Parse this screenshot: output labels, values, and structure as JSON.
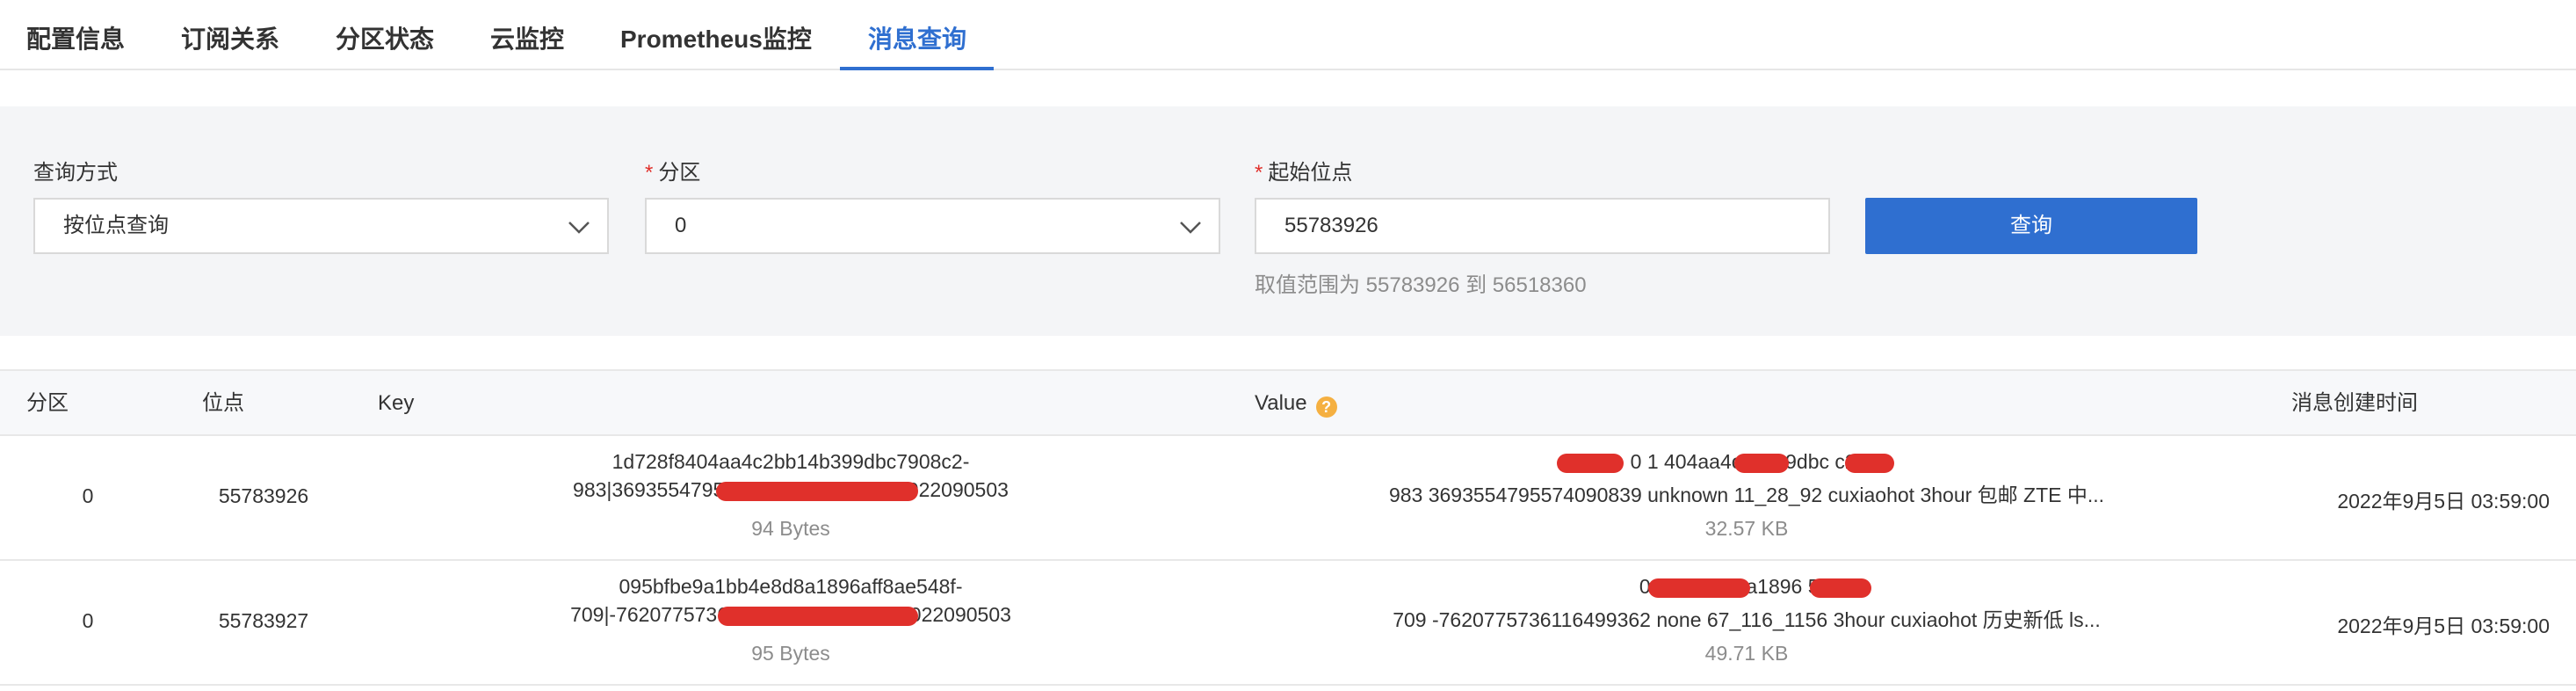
{
  "tabs": [
    {
      "label": "配置信息"
    },
    {
      "label": "订阅关系"
    },
    {
      "label": "分区状态"
    },
    {
      "label": "云监控"
    },
    {
      "label": "Prometheus监控"
    },
    {
      "label": "消息查询",
      "active": true
    }
  ],
  "query": {
    "method_label": "查询方式",
    "method_value": "按位点查询",
    "partition_label": "分区",
    "partition_value": "0",
    "offset_label": "起始位点",
    "offset_value": "55783926",
    "required_mark": "*",
    "range_hint": "取值范围为 55783926 到 56518360",
    "submit_label": "查询"
  },
  "table": {
    "columns": {
      "partition": "分区",
      "offset": "位点",
      "key": "Key",
      "value": "Value",
      "value_help": "?",
      "created": "消息创建时间"
    },
    "rows": [
      {
        "partition": "0",
        "offset": "55783926",
        "key_line1": "1d728f8404aa4c2bb14b399dbc7908c2-",
        "key_line2": "983|3693554795574090839|                                        |feeds|2022090503",
        "key_size": "94 Bytes",
        "value_line1": "0 1                404aa4c2bl             99dbc        c2-",
        "value_line2": "983 3693554795574090839 unknown 11_28_92 cuxiaohot 3hour 包邮 ZTE 中...",
        "value_size": "32.57 KB",
        "created": "2022年9月5日 03:59:00"
      },
      {
        "partition": "0",
        "offset": "55783927",
        "key_line1": "095bfbe9a1bb4e8d8a1896aff8ae548f-",
        "key_line2": "709|-7620775736116499362|                                       |feeds|2022090503",
        "key_size": "95 Bytes",
        "value_line1": "0 095bfbe9                a1896        548f-",
        "value_line2": "709 -7620775736116499362 none 67_116_1156 3hour cuxiaohot 历史新低 ls...",
        "value_size": "49.71 KB",
        "created": "2022年9月5日 03:59:00"
      }
    ]
  },
  "colors": {
    "accent": "#2f6fd0",
    "required": "#e0302b",
    "help_icon": "#f5b041",
    "panel_bg": "#f4f5f7"
  },
  "icons": [
    "chevron-down-icon",
    "help-icon"
  ]
}
